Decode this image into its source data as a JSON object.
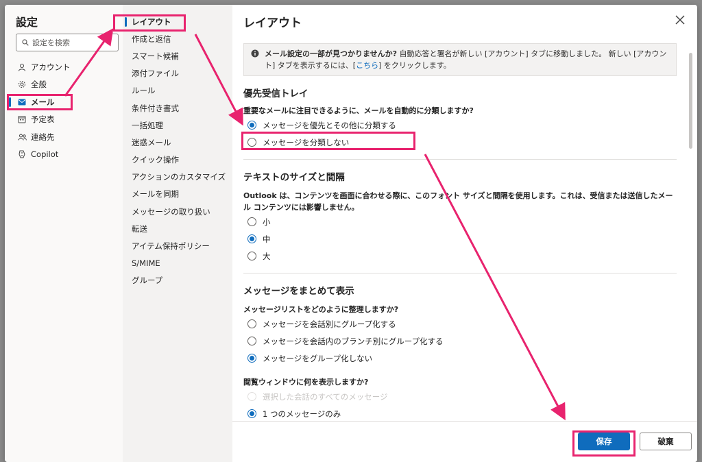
{
  "settings": {
    "title": "設定",
    "search_placeholder": "設定を検索",
    "nav": [
      {
        "label": "アカウント",
        "icon": "person-icon"
      },
      {
        "label": "全般",
        "icon": "gear-icon"
      },
      {
        "label": "メール",
        "icon": "mail-icon",
        "active": true
      },
      {
        "label": "予定表",
        "icon": "calendar-icon"
      },
      {
        "label": "連絡先",
        "icon": "people-icon"
      },
      {
        "label": "Copilot",
        "icon": "copilot-icon"
      }
    ]
  },
  "mail_nav": [
    {
      "label": "レイアウト",
      "active": true
    },
    {
      "label": "作成と返信"
    },
    {
      "label": "スマート候補"
    },
    {
      "label": "添付ファイル"
    },
    {
      "label": "ルール"
    },
    {
      "label": "条件付き書式"
    },
    {
      "label": "一括処理"
    },
    {
      "label": "迷惑メール"
    },
    {
      "label": "クイック操作"
    },
    {
      "label": "アクションのカスタマイズ"
    },
    {
      "label": "メールを同期"
    },
    {
      "label": "メッセージの取り扱い"
    },
    {
      "label": "転送"
    },
    {
      "label": "アイテム保持ポリシー"
    },
    {
      "label": "S/MIME"
    },
    {
      "label": "グループ"
    }
  ],
  "content": {
    "title": "レイアウト",
    "notice": {
      "bold": "メール設定の一部が見つかりませんか?",
      "text1": " 自動応答と署名が新しい [アカウント] タブに移動しました。 新しい [アカウント] タブを表示するには、[",
      "link": "こちら",
      "text2": "] をクリックします。"
    },
    "focused_inbox": {
      "title": "優先受信トレイ",
      "question": "重要なメールに注目できるように、メールを自動的に分類しますか?",
      "options": [
        {
          "label": "メッセージを優先とその他に分類する",
          "selected": true
        },
        {
          "label": "メッセージを分類しない",
          "selected": false
        }
      ]
    },
    "text_size": {
      "title": "テキストのサイズと間隔",
      "description": "Outlook は、コンテンツを画面に合わせる際に、このフォント サイズと間隔を使用します。これは、受信または送信したメール コンテンツには影響しません。",
      "options": [
        {
          "label": "小",
          "selected": false
        },
        {
          "label": "中",
          "selected": true
        },
        {
          "label": "大",
          "selected": false
        }
      ]
    },
    "conversation": {
      "title": "メッセージをまとめて表示",
      "question": "メッセージリストをどのように整理しますか?",
      "options": [
        {
          "label": "メッセージを会話別にグループ化する",
          "selected": false
        },
        {
          "label": "メッセージを会話内のブランチ別にグループ化する",
          "selected": false
        },
        {
          "label": "メッセージをグループ化しない",
          "selected": true
        }
      ],
      "reading_question": "閲覧ウィンドウに何を表示しますか?",
      "reading_options": [
        {
          "label": "選択した会話のすべてのメッセージ",
          "selected": false,
          "disabled": true
        },
        {
          "label": "1 つのメッセージのみ",
          "selected": true
        }
      ]
    },
    "save_label": "保存",
    "discard_label": "破棄"
  },
  "annotation_color": "#e8236e",
  "accent_color": "#0f6cbd"
}
